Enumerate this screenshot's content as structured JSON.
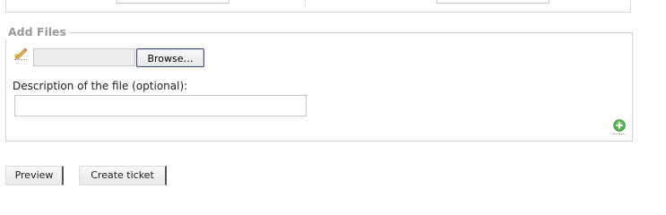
{
  "add_files": {
    "legend": "Add Files",
    "browse_label": "Browse…",
    "description_label": "Description of the file (optional):",
    "icons": {
      "attachment": "pencil-icon",
      "add_more": "add-icon"
    }
  },
  "actions": {
    "preview_label": "Preview",
    "create_label": "Create ticket"
  },
  "colors": {
    "legend_text": "#999999",
    "add_icon": "#3aa63a",
    "browse_border": "#334a73"
  }
}
